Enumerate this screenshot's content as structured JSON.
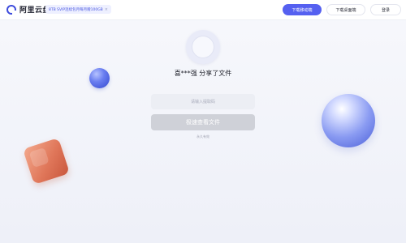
{
  "header": {
    "logo_text": "阿里云盘",
    "promo_text": "8TB SVIP连续包月每月赠100GB",
    "promo_close": "×",
    "download_mobile_label": "下载移动端",
    "download_desktop_label": "下载桌面端",
    "login_label": "登录"
  },
  "share": {
    "title": "喜***强 分享了文件",
    "code_placeholder": "请输入提取码",
    "code_value": "",
    "submit_label": "极速查看文件",
    "expiry_text": "永久有效"
  },
  "colors": {
    "accent": "#5560f0",
    "disabled_button": "#cfd1d8",
    "input_bg": "#eceef4",
    "ball_blue": "#4a5ed8",
    "cube_orange": "#e0775a"
  }
}
